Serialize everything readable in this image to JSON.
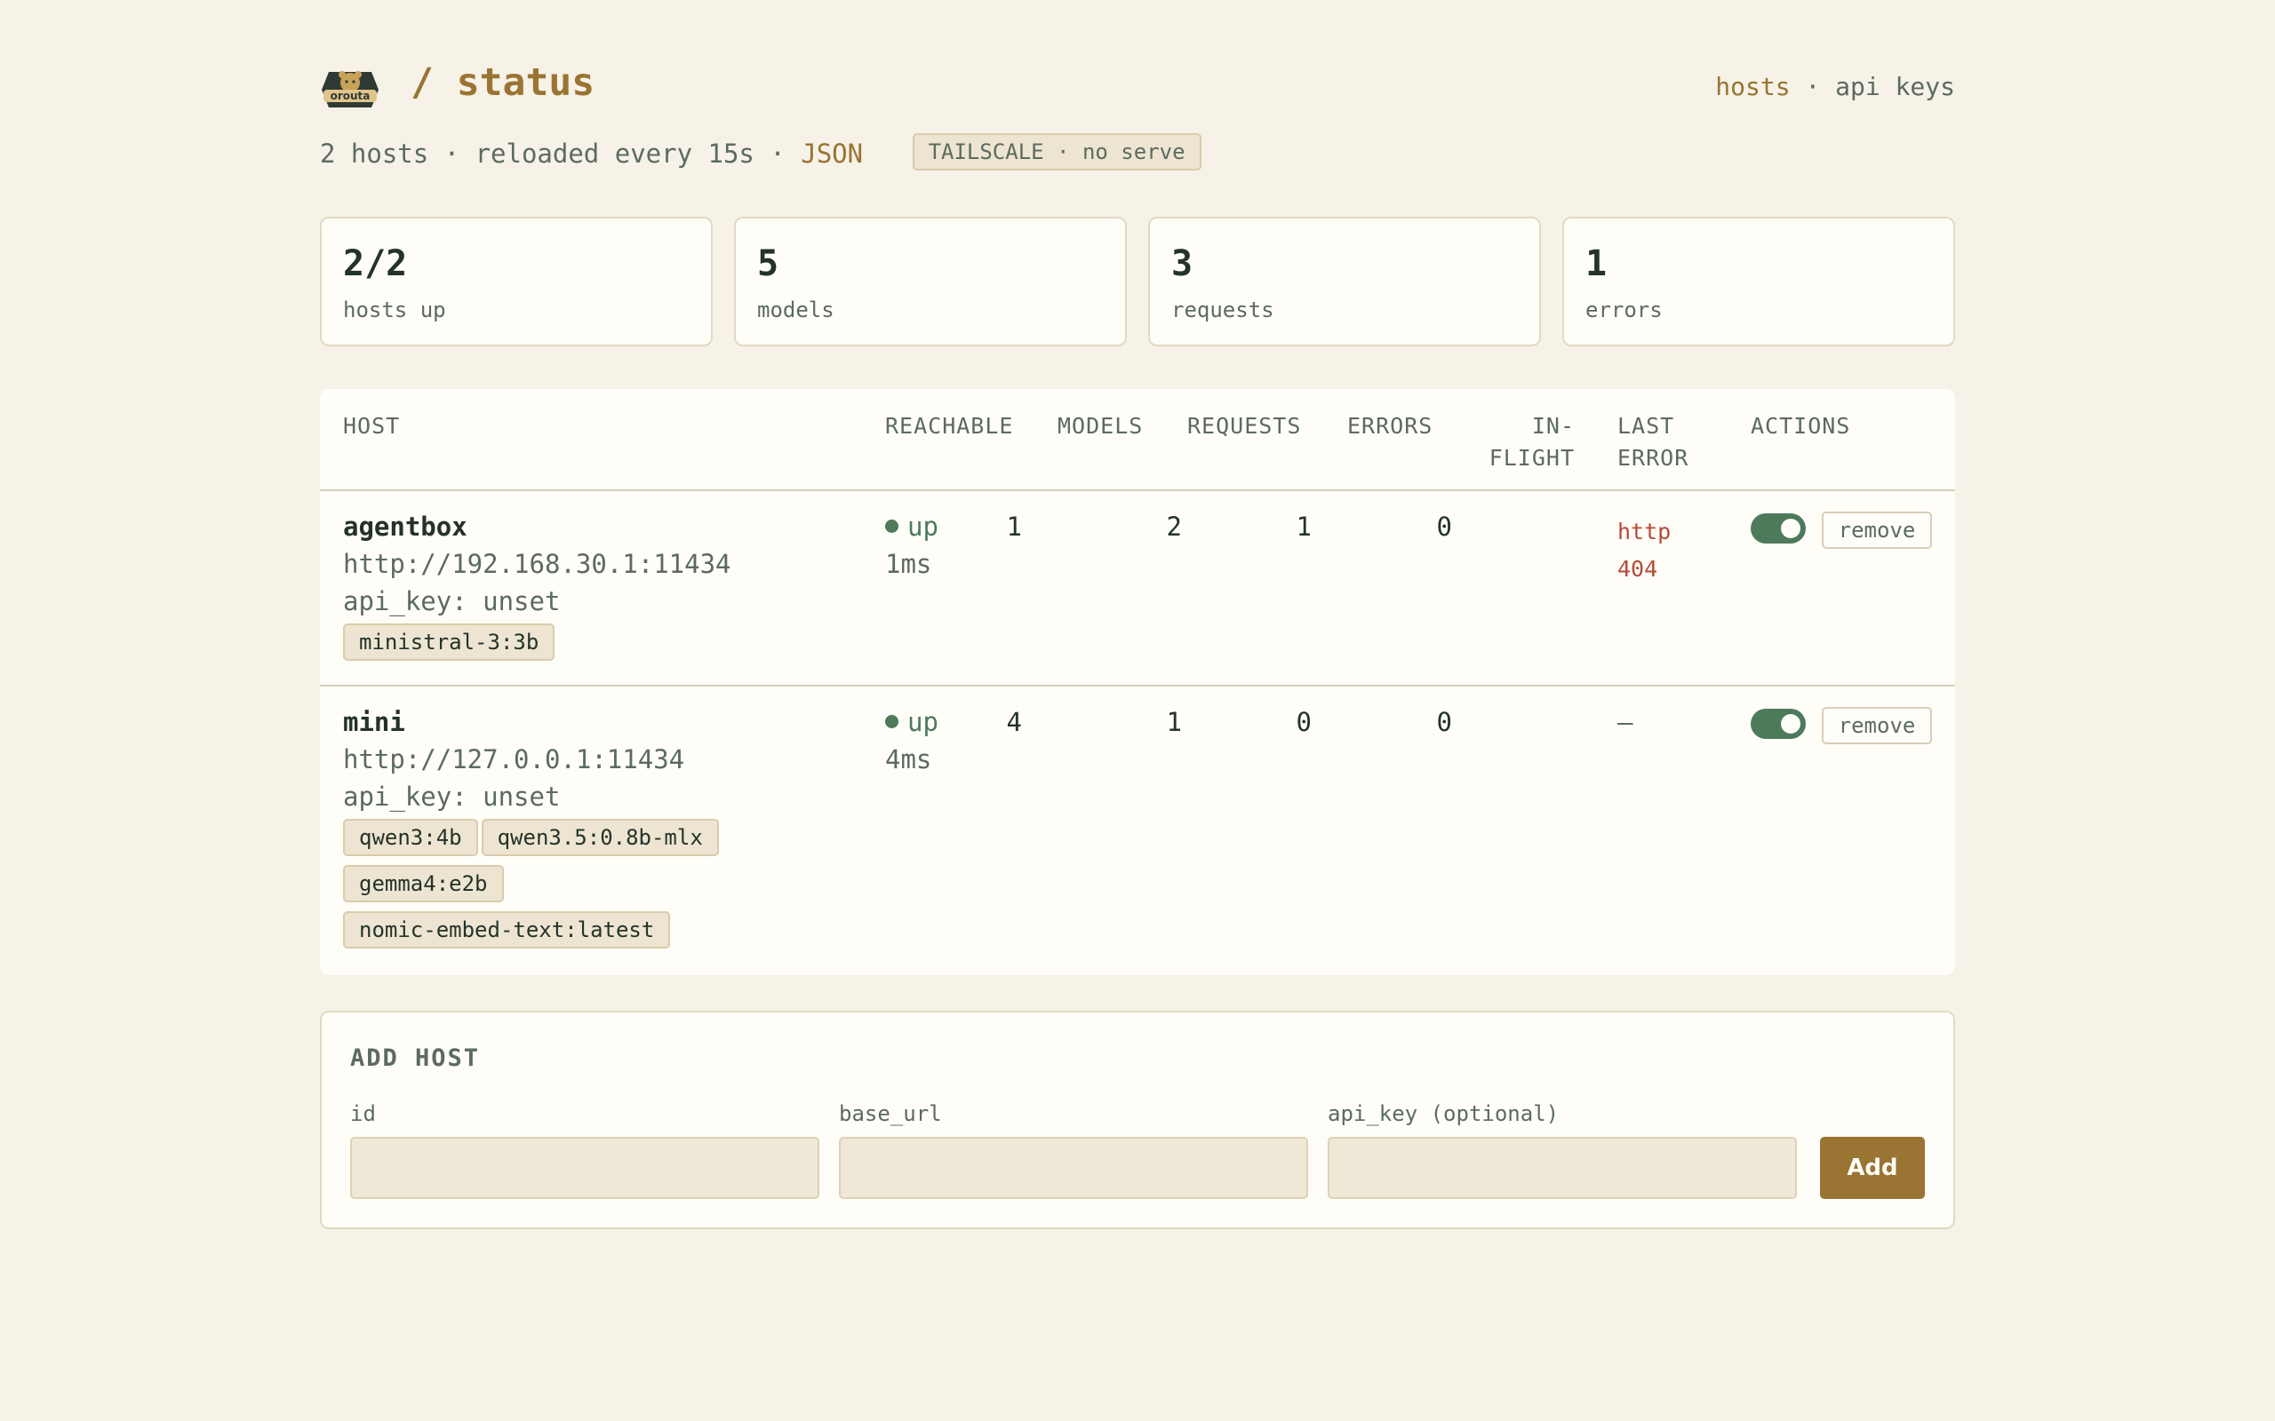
{
  "header": {
    "title": "/ status",
    "logo_text": "orouta",
    "nav": {
      "hosts": "hosts",
      "separator": "·",
      "api_keys": "api keys"
    }
  },
  "subline": {
    "summary": "2 hosts · reloaded every 15s · ",
    "json_link": "JSON",
    "tailscale_badge": "TAILSCALE · no serve"
  },
  "stats": [
    {
      "value": "2/2",
      "label": "hosts up"
    },
    {
      "value": "5",
      "label": "models"
    },
    {
      "value": "3",
      "label": "requests"
    },
    {
      "value": "1",
      "label": "errors"
    }
  ],
  "table": {
    "columns": {
      "host": "HOST",
      "reachable": "REACHABLE",
      "models": "MODELS",
      "requests": "REQUESTS",
      "errors": "ERRORS",
      "in_flight_1": "IN-",
      "in_flight_2": "FLIGHT",
      "last_error_1": "LAST",
      "last_error_2": "ERROR",
      "actions": "ACTIONS"
    },
    "rows": [
      {
        "id": "agentbox",
        "url": "http://192.168.30.1:11434",
        "api_key": "api_key: unset",
        "tags": [
          "ministral-3:3b"
        ],
        "status": "up",
        "latency": "1ms",
        "models": "1",
        "requests": "2",
        "errors": "1",
        "in_flight": "0",
        "last_error": "http 404",
        "enabled": true,
        "remove_label": "remove"
      },
      {
        "id": "mini",
        "url": "http://127.0.0.1:11434",
        "api_key": "api_key: unset",
        "tags": [
          "qwen3:4b",
          "qwen3.5:0.8b-mlx",
          "gemma4:e2b",
          "nomic-embed-text:latest"
        ],
        "status": "up",
        "latency": "4ms",
        "models": "4",
        "requests": "1",
        "errors": "0",
        "in_flight": "0",
        "last_error": "—",
        "enabled": true,
        "remove_label": "remove"
      }
    ]
  },
  "add_host": {
    "title": "ADD HOST",
    "fields": [
      {
        "label": "id",
        "value": "",
        "placeholder": ""
      },
      {
        "label": "base_url",
        "value": "",
        "placeholder": ""
      },
      {
        "label": "api_key (optional)",
        "value": "",
        "placeholder": ""
      }
    ],
    "submit_label": "Add"
  },
  "colors": {
    "background": "#f6f2e8",
    "accent": "#9a7432",
    "ok": "#4e7a5c",
    "error": "#b54a3a"
  }
}
